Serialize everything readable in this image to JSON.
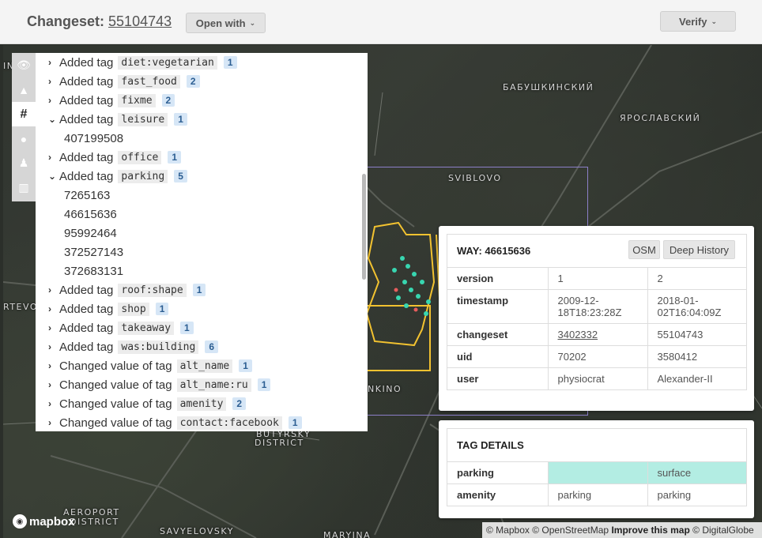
{
  "header": {
    "title_prefix": "Changeset:",
    "changeset_id": "55104743",
    "open_with_label": "Open with",
    "verify_label": "Verify"
  },
  "map": {
    "labels": {
      "babushkinsky": "БАБУШКИНСКИЙ",
      "yaroslavsky": "ЯРОСЛАВСКИЙ",
      "sviblovo": "SVIBLOVO",
      "ankino": "ANKINO",
      "butyrsky": "BUTYRSKY",
      "district": "DISTRICT",
      "aeroport": "AEROPORT",
      "district2": "DISTRICT",
      "savyelovsky": "SAVYELOVSKY",
      "maryina": "MARYINA",
      "rtevo": "RTEVO",
      "ino": "INO"
    },
    "logo_text": "mapbox",
    "attribution": {
      "mapbox": "© Mapbox",
      "osm": "© OpenStreetMap",
      "improve": "Improve this map",
      "digitalglobe": "© DigitalGlobe"
    },
    "bbox_color": "#8c7fc8",
    "feature_color": "#f2c230",
    "point_color": "#38d6b0"
  },
  "rail": {
    "icons": [
      "eye-icon",
      "warning-icon",
      "hash-icon",
      "comment-icon",
      "user-icon",
      "map-icon"
    ],
    "active": "hash-icon"
  },
  "tag_panel": {
    "rows": [
      {
        "action": "Added tag",
        "tag": "diet:vegetarian",
        "count": "1",
        "expanded": false
      },
      {
        "action": "Added tag",
        "tag": "fast_food",
        "count": "2",
        "expanded": false
      },
      {
        "action": "Added tag",
        "tag": "fixme",
        "count": "2",
        "expanded": false
      },
      {
        "action": "Added tag",
        "tag": "leisure",
        "count": "1",
        "expanded": true,
        "items": [
          "407199508"
        ]
      },
      {
        "action": "Added tag",
        "tag": "office",
        "count": "1",
        "expanded": false
      },
      {
        "action": "Added tag",
        "tag": "parking",
        "count": "5",
        "expanded": true,
        "items": [
          "7265163",
          "46615636",
          "95992464",
          "372527143",
          "372683131"
        ]
      },
      {
        "action": "Added tag",
        "tag": "roof:shape",
        "count": "1",
        "expanded": false
      },
      {
        "action": "Added tag",
        "tag": "shop",
        "count": "1",
        "expanded": false
      },
      {
        "action": "Added tag",
        "tag": "takeaway",
        "count": "1",
        "expanded": false
      },
      {
        "action": "Added tag",
        "tag": "was:building",
        "count": "6",
        "expanded": false
      },
      {
        "action": "Changed value of tag",
        "tag": "alt_name",
        "count": "1",
        "expanded": false
      },
      {
        "action": "Changed value of tag",
        "tag": "alt_name:ru",
        "count": "1",
        "expanded": false
      },
      {
        "action": "Changed value of tag",
        "tag": "amenity",
        "count": "2",
        "expanded": false
      },
      {
        "action": "Changed value of tag",
        "tag": "contact:facebook",
        "count": "1",
        "expanded": false
      }
    ]
  },
  "way_popup": {
    "title": "WAY: 46615636",
    "osm_label": "OSM",
    "deep_history_label": "Deep History",
    "rows": [
      {
        "key": "version",
        "old": "1",
        "new": "2"
      },
      {
        "key": "timestamp",
        "old": "2009-12-18T18:23:28Z",
        "new": "2018-01-02T16:04:09Z"
      },
      {
        "key": "changeset",
        "old": "3402332",
        "new": "55104743"
      },
      {
        "key": "uid",
        "old": "70202",
        "new": "3580412"
      },
      {
        "key": "user",
        "old": "physiocrat",
        "new": "Alexander-II"
      }
    ]
  },
  "tag_details": {
    "title": "TAG DETAILS",
    "rows": [
      {
        "key": "parking",
        "old": "",
        "new": "surface",
        "highlight": true
      },
      {
        "key": "amenity",
        "old": "parking",
        "new": "parking",
        "highlight": false
      }
    ],
    "highlight_color": "#b3ede3"
  }
}
